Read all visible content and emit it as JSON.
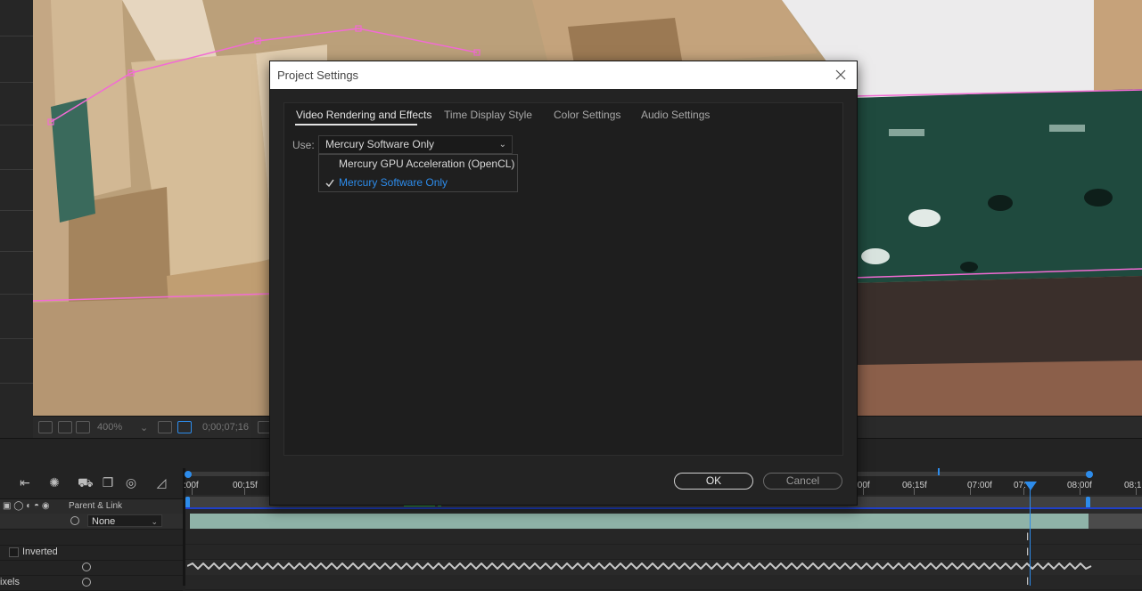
{
  "viewer": {
    "zoom": "400%",
    "timecode": "0;00;07;16"
  },
  "timeline": {
    "ruler_labels": [
      ":00f",
      "00:15f",
      ":00f",
      "06:15f",
      "07:00f",
      "07:",
      "08:00f",
      "08:1"
    ],
    "column_header": "Parent & Link",
    "parent_value": "None",
    "inverted_label": "Inverted",
    "pixels_label": "ixels"
  },
  "dialog": {
    "title": "Project Settings",
    "tabs": [
      {
        "label": "Video Rendering and Effects",
        "active": true
      },
      {
        "label": "Time Display Style",
        "active": false
      },
      {
        "label": "Color Settings",
        "active": false
      },
      {
        "label": "Audio Settings",
        "active": false
      }
    ],
    "use_label": "Use:",
    "use_selected": "Mercury Software Only",
    "options": [
      {
        "label": "Mercury GPU Acceleration (OpenCL)",
        "checked": false
      },
      {
        "label": "Mercury Software Only",
        "checked": true
      }
    ],
    "ok_label": "OK",
    "cancel_label": "Cancel"
  },
  "colors": {
    "accent_blue": "#2d8ceb",
    "mask_pink": "#f26bd4",
    "selected_option": "#2d8ceb"
  }
}
